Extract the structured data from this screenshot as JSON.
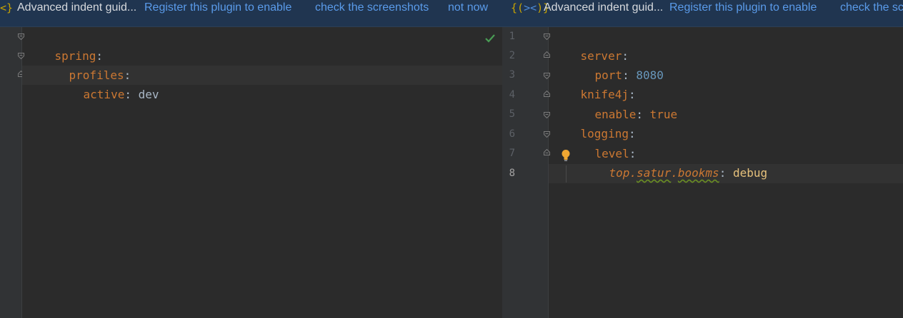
{
  "banner_left": {
    "logo": "<}",
    "title": "Advanced indent guid...",
    "register": "Register this plugin to enable",
    "screenshots": "check the screenshots",
    "not_now": "not now"
  },
  "banner_right": {
    "logo_open": "{(",
    "logo_inner": "><",
    "logo_close": ")}",
    "title": "Advanced indent guid...",
    "register": "Register this plugin to enable",
    "screenshots": "check the sc"
  },
  "left_editor": {
    "lines": [
      {
        "key": "spring",
        "colon": ":",
        "value": ""
      },
      {
        "key": "profiles",
        "colon": ":",
        "value": ""
      },
      {
        "key": "active",
        "colon": ":",
        "value": "dev"
      }
    ]
  },
  "right_editor": {
    "line_numbers": [
      "1",
      "2",
      "3",
      "4",
      "5",
      "6",
      "7",
      "8"
    ],
    "lines": [
      {
        "key": "server",
        "colon": ":",
        "value": ""
      },
      {
        "key": "port",
        "colon": ":",
        "value": "8080"
      },
      {
        "key": "knife4j",
        "colon": ":",
        "value": ""
      },
      {
        "key": "enable",
        "colon": ":",
        "value": "true"
      },
      {
        "key": "logging",
        "colon": ":",
        "value": ""
      },
      {
        "key": "level",
        "colon": ":",
        "value": ""
      },
      {
        "key_parts": [
          "top",
          ".",
          "satur",
          ".",
          "bookms"
        ],
        "colon": ":",
        "value": "debug"
      }
    ]
  },
  "colors": {
    "key": "#cc7832",
    "number": "#6897bb",
    "check": "#499c54",
    "bulb": "#f0a732",
    "link": "#5a9bea",
    "banner_bg": "#203550"
  }
}
